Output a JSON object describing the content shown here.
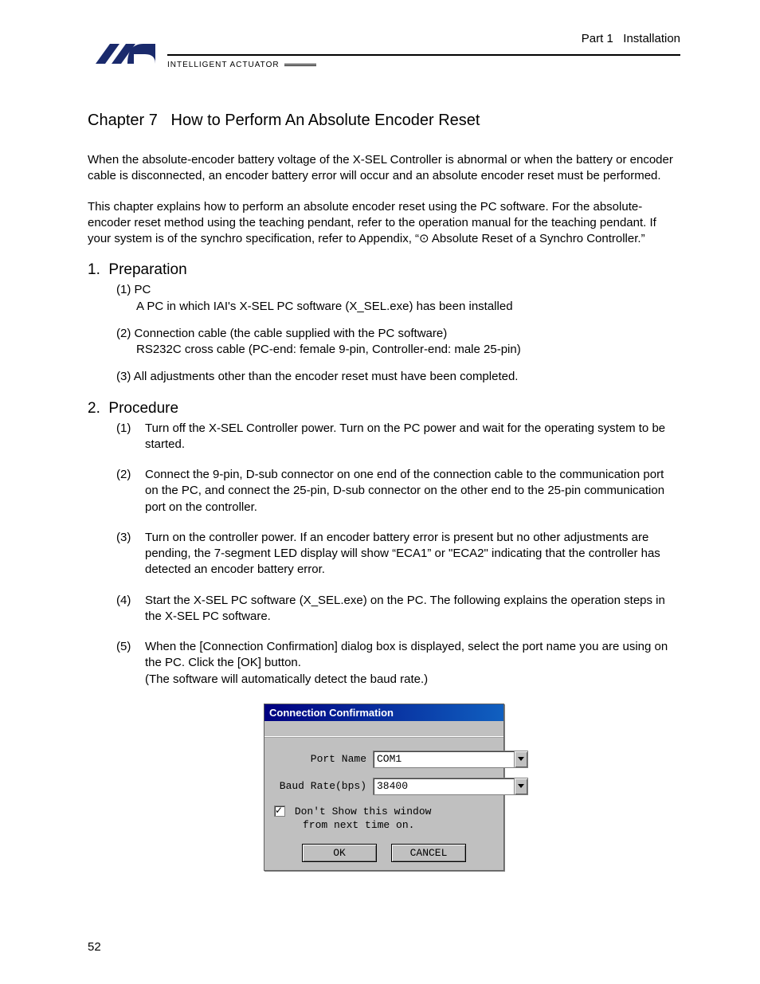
{
  "header": {
    "part_label": "Part 1   Installation",
    "subhead": "INTELLIGENT ACTUATOR"
  },
  "chapter_title": "Chapter 7   How to Perform An Absolute Encoder Reset",
  "intro_para_1": "When the absolute-encoder battery voltage of the X-SEL Controller is abnormal or when the battery or encoder cable is disconnected, an encoder battery error will occur and an absolute encoder reset must be performed.",
  "intro_para_2": "This chapter explains how to perform an absolute encoder reset using the PC software. For the absolute-encoder reset method using the teaching pendant, refer to the operation manual for the teaching pendant. If your system is of the synchro specification, refer to Appendix, “⊙ Absolute Reset of a Synchro Controller.”",
  "section1": {
    "title": "1.  Preparation",
    "items": [
      {
        "num": "(1)",
        "head": "PC",
        "sub": "A PC in which IAI's X-SEL PC software (X_SEL.exe) has been installed"
      },
      {
        "num": "(2)",
        "head": "Connection cable (the cable supplied with the PC software)",
        "sub": "RS232C cross cable (PC-end: female 9-pin, Controller-end: male 25-pin)"
      },
      {
        "num": "(3)",
        "head": "All adjustments other than the encoder reset must have been completed.",
        "sub": ""
      }
    ]
  },
  "section2": {
    "title": "2.  Procedure",
    "items": [
      {
        "num": "(1)",
        "text": "Turn off the X-SEL Controller power. Turn on the PC power and wait for the operating system to be started."
      },
      {
        "num": "(2)",
        "text": "Connect the 9-pin, D-sub connector on one end of the connection cable to the communication port on the PC, and connect the 25-pin, D-sub connector on the other end to the 25-pin communication port on the controller."
      },
      {
        "num": "(3)",
        "text": "Turn on the controller power. If an encoder battery error is present but no other adjustments are pending, the 7-segment LED display will show “ECA1” or \"ECA2\" indicating that the controller has detected an encoder battery error."
      },
      {
        "num": "(4)",
        "text": "Start the X-SEL PC software (X_SEL.exe) on the PC. The following explains the operation steps in the X-SEL PC software."
      },
      {
        "num": "(5)",
        "text": "When the [Connection Confirmation] dialog box is displayed, select the port name you are using on the PC. Click the [OK] button.\n(The software will automatically detect the baud rate.)"
      }
    ]
  },
  "dialog": {
    "title": "Connection Confirmation",
    "port_label": "Port Name",
    "port_value": "COM1",
    "baud_label": "Baud Rate(bps)",
    "baud_value": "38400",
    "check_line1": "Don't Show this window",
    "check_line2": "from next time on.",
    "ok_label": "OK",
    "cancel_label": "CANCEL"
  },
  "page_number": "52"
}
